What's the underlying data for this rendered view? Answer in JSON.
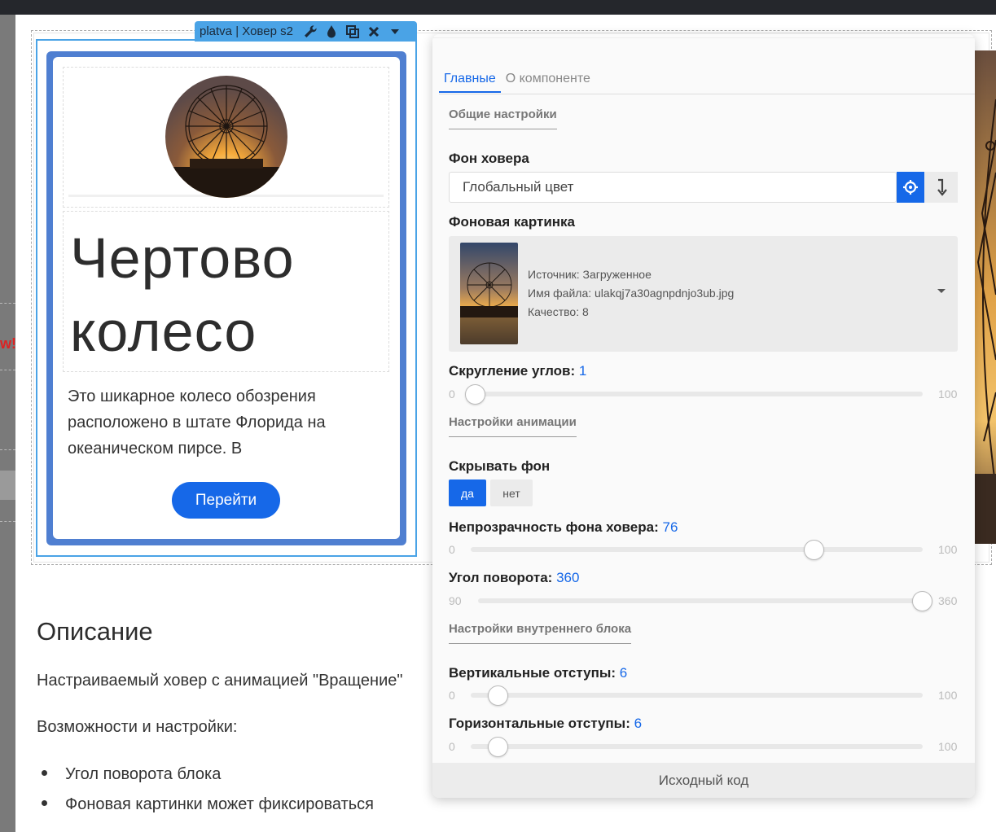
{
  "component_toolbar": {
    "title": "platva | Ховер s2"
  },
  "left_edge": {
    "fragment": "w!"
  },
  "card": {
    "title_line1": "Чертово",
    "title_line2": "колесо",
    "description": "Это шикарное колесо обозрения расположено в штате Флорида на океаническом пирсе. В",
    "button_label": "Перейти"
  },
  "content": {
    "heading": "Описание",
    "paragraph1": "Настраиваемый ховер с анимацией \"Вращение\"",
    "paragraph2": "Возможности и настройки:",
    "bullets": [
      "Угол поворота блока",
      "Фоновая картинки может фиксироваться"
    ]
  },
  "panel": {
    "tabs": [
      {
        "label": "Главные",
        "active": true
      },
      {
        "label": "О компоненте",
        "active": false
      }
    ],
    "general_section": "Общие настройки",
    "hover_bg": {
      "label": "Фон ховера",
      "value": "Глобальный цвет"
    },
    "bg_image": {
      "label": "Фоновая картинка",
      "source": "Источник: Загруженное",
      "filename": "Имя файла: ulakqj7a30agnpdnjo3ub.jpg",
      "quality": "Качество: 8"
    },
    "corner_radius": {
      "label": "Скругление углов:",
      "value": "1",
      "min": "0",
      "max": "100"
    },
    "animation_section": "Настройки анимации",
    "hide_bg": {
      "label": "Скрывать фон",
      "yes": "да",
      "no": "нет",
      "selected": "да"
    },
    "hover_opacity": {
      "label": "Непрозрачность фона ховера:",
      "value": "76",
      "min": "0",
      "max": "100"
    },
    "rotation_angle": {
      "label": "Угол поворота:",
      "value": "360",
      "min": "90",
      "max": "360"
    },
    "inner_section": "Настройки внутреннего блока",
    "vertical_padding": {
      "label": "Вертикальные отступы:",
      "value": "6",
      "min": "0",
      "max": "100"
    },
    "horizontal_padding": {
      "label": "Горизонтальные отступы:",
      "value": "6",
      "min": "0",
      "max": "100"
    },
    "footer_button": "Исходный код"
  },
  "colors": {
    "accent": "#1668e8",
    "selection": "#4aa3e6",
    "card_border": "#4f7fd1"
  }
}
